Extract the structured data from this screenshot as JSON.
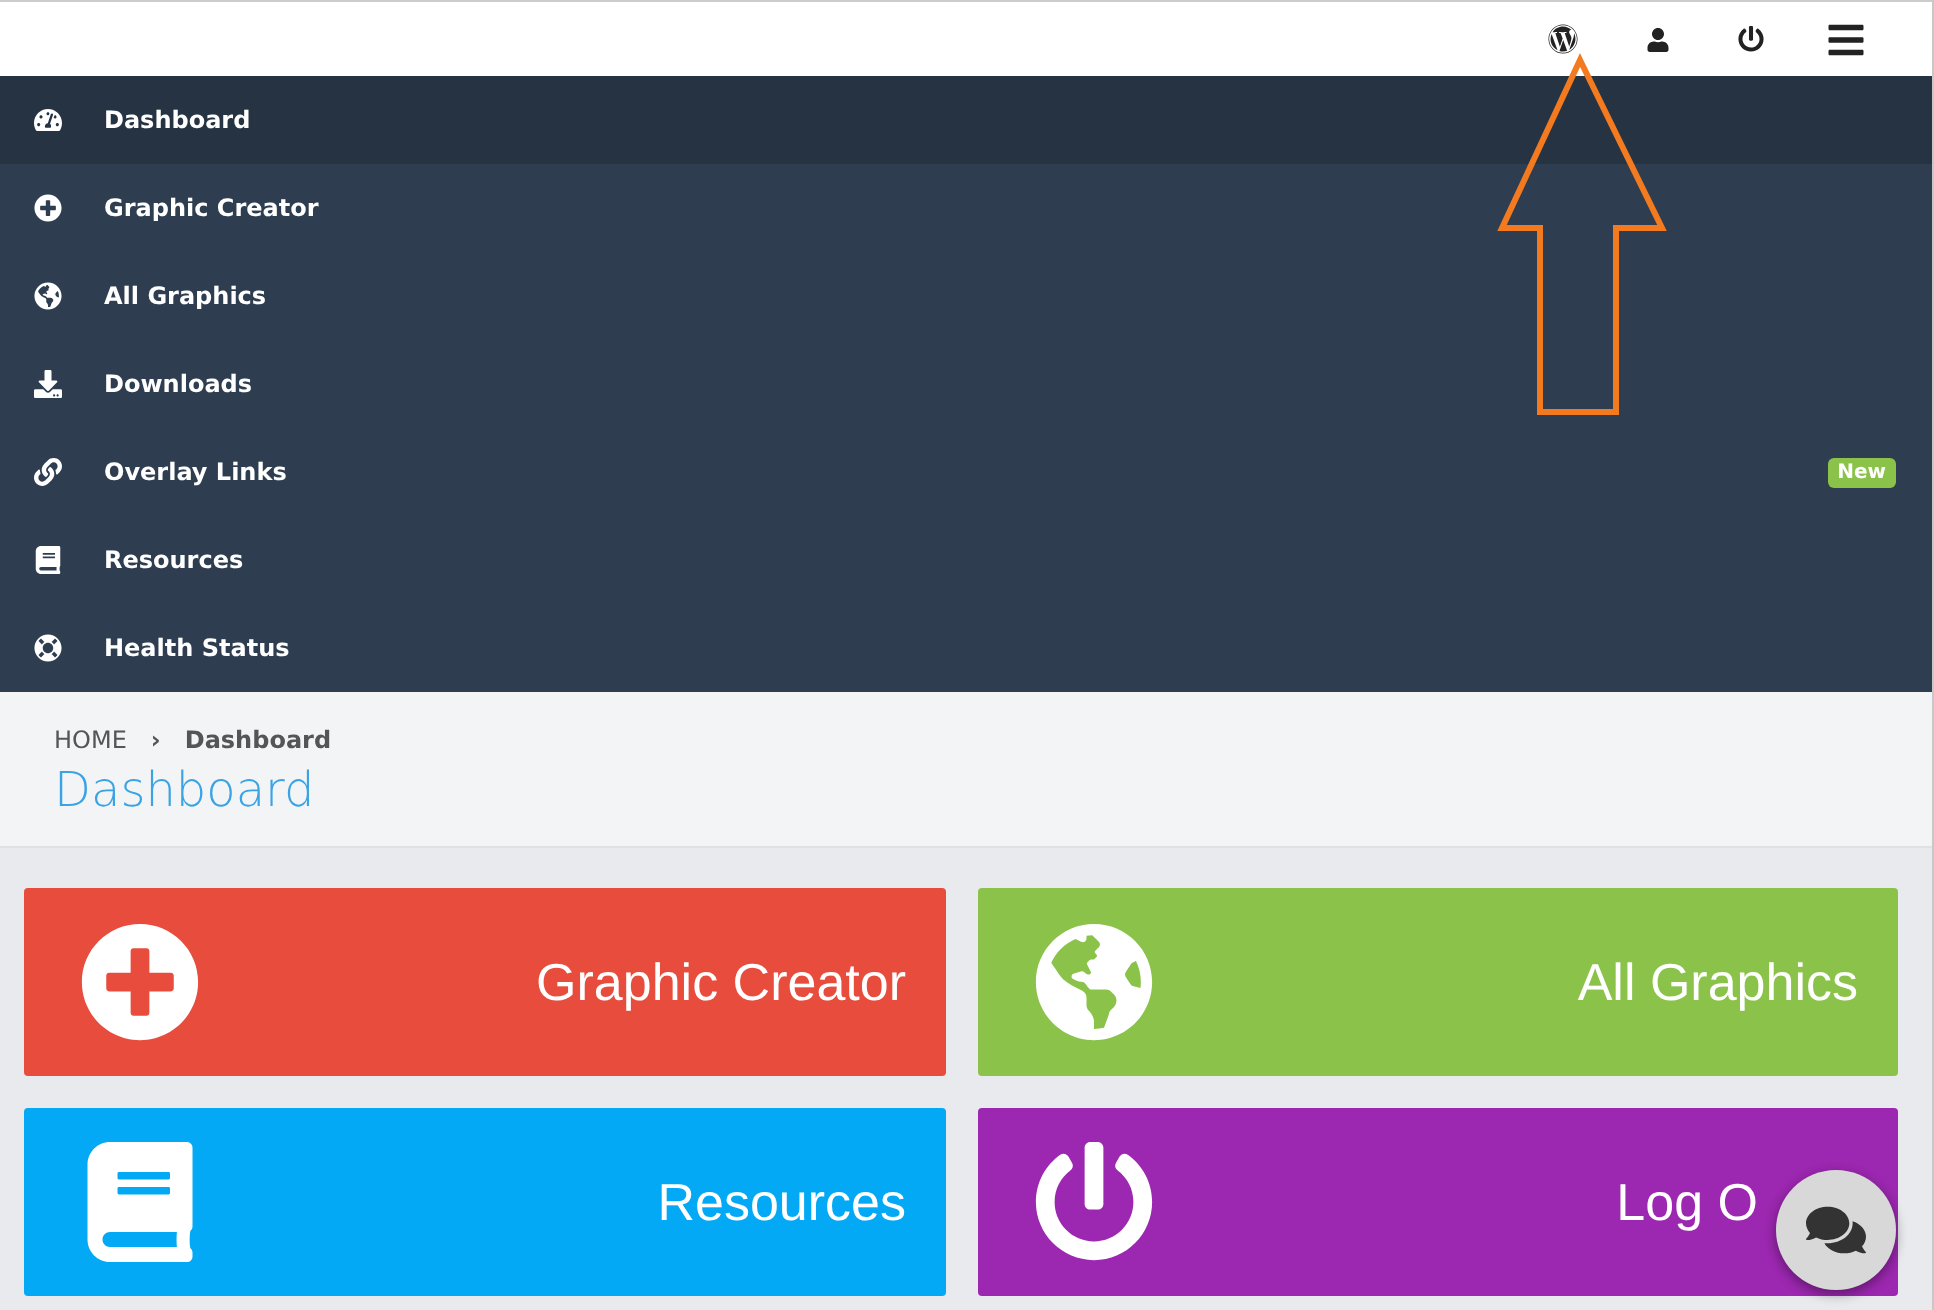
{
  "menu": [
    {
      "label": "Dashboard",
      "kind": "gauge",
      "selected": true
    },
    {
      "label": "Graphic Creator",
      "kind": "plus",
      "selected": false
    },
    {
      "label": "All Graphics",
      "kind": "globe",
      "selected": false
    },
    {
      "label": "Downloads",
      "kind": "download",
      "selected": false
    },
    {
      "label": "Overlay Links",
      "kind": "link",
      "selected": false,
      "badge": "New"
    },
    {
      "label": "Resources",
      "kind": "book",
      "selected": false
    },
    {
      "label": "Health Status",
      "kind": "lifebuoy",
      "selected": false
    }
  ],
  "breadcrumb": {
    "home": "HOME",
    "separator": "›",
    "current": "Dashboard"
  },
  "page_title": "Dashboard",
  "tiles": [
    {
      "label": "Graphic Creator",
      "kind": "plus",
      "color": "#e74c3c"
    },
    {
      "label": "All Graphics",
      "kind": "globe",
      "color": "#8bc34a"
    },
    {
      "label": "Resources",
      "kind": "book",
      "color": "#03a9f4"
    },
    {
      "label": "Log O",
      "kind": "power",
      "color": "#9c27b0"
    }
  ]
}
